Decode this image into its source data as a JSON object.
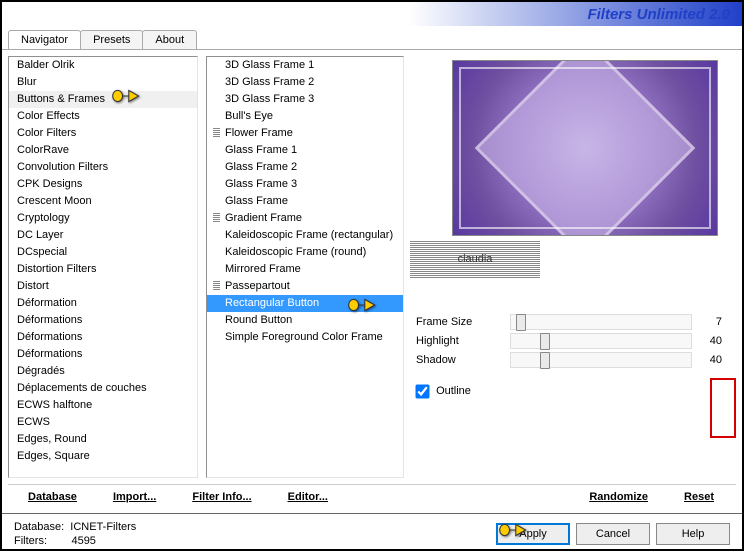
{
  "title": "Filters Unlimited 2.0",
  "tabs": [
    {
      "label": "Navigator",
      "active": true
    },
    {
      "label": "Presets",
      "active": false
    },
    {
      "label": "About",
      "active": false
    }
  ],
  "categories": [
    "Balder Olrik",
    "Blur",
    "Buttons & Frames",
    "Color Effects",
    "Color Filters",
    "ColorRave",
    "Convolution Filters",
    "CPK Designs",
    "Crescent Moon",
    "Cryptology",
    "DC Layer",
    "DCspecial",
    "Distortion Filters",
    "Distort",
    "Déformation",
    "Déformations",
    "Déformations",
    "Déformations",
    "Dégradés",
    "Déplacements de couches",
    "ECWS halftone",
    "ECWS",
    "Edges, Round",
    "Edges, Square"
  ],
  "selectedCategoryIndex": 2,
  "filters": [
    {
      "label": "3D Glass Frame 1",
      "h": false
    },
    {
      "label": "3D Glass Frame 2",
      "h": false
    },
    {
      "label": "3D Glass Frame 3",
      "h": false
    },
    {
      "label": "Bull's Eye",
      "h": false
    },
    {
      "label": "Flower Frame",
      "h": true
    },
    {
      "label": "Glass Frame 1",
      "h": false
    },
    {
      "label": "Glass Frame 2",
      "h": false
    },
    {
      "label": "Glass Frame 3",
      "h": false
    },
    {
      "label": "Glass Frame",
      "h": false
    },
    {
      "label": "Gradient Frame",
      "h": true
    },
    {
      "label": "Kaleidoscopic Frame (rectangular)",
      "h": false
    },
    {
      "label": "Kaleidoscopic Frame (round)",
      "h": false
    },
    {
      "label": "Mirrored Frame",
      "h": false
    },
    {
      "label": "Passepartout",
      "h": true
    },
    {
      "label": "Rectangular Button",
      "h": false
    },
    {
      "label": "Round Button",
      "h": false
    },
    {
      "label": "Simple Foreground Color Frame",
      "h": false
    }
  ],
  "selectedFilterIndex": 14,
  "filterTitle": "Rectangular Button",
  "params": [
    {
      "name": "Frame Size",
      "value": 7,
      "pct": 3
    },
    {
      "name": "Highlight",
      "value": 40,
      "pct": 16
    },
    {
      "name": "Shadow",
      "value": 40,
      "pct": 16
    }
  ],
  "outline": {
    "label": "Outline",
    "checked": true
  },
  "toolbar": {
    "database": "Database",
    "import": "Import...",
    "filterinfo": "Filter Info...",
    "editor": "Editor...",
    "randomize": "Randomize",
    "reset": "Reset"
  },
  "footer": {
    "dblabel": "Database:",
    "dbval": "ICNET-Filters",
    "flabel": "Filters:",
    "fval": "4595"
  },
  "buttons": {
    "apply": "Apply",
    "cancel": "Cancel",
    "help": "Help"
  },
  "logo": "claudia"
}
